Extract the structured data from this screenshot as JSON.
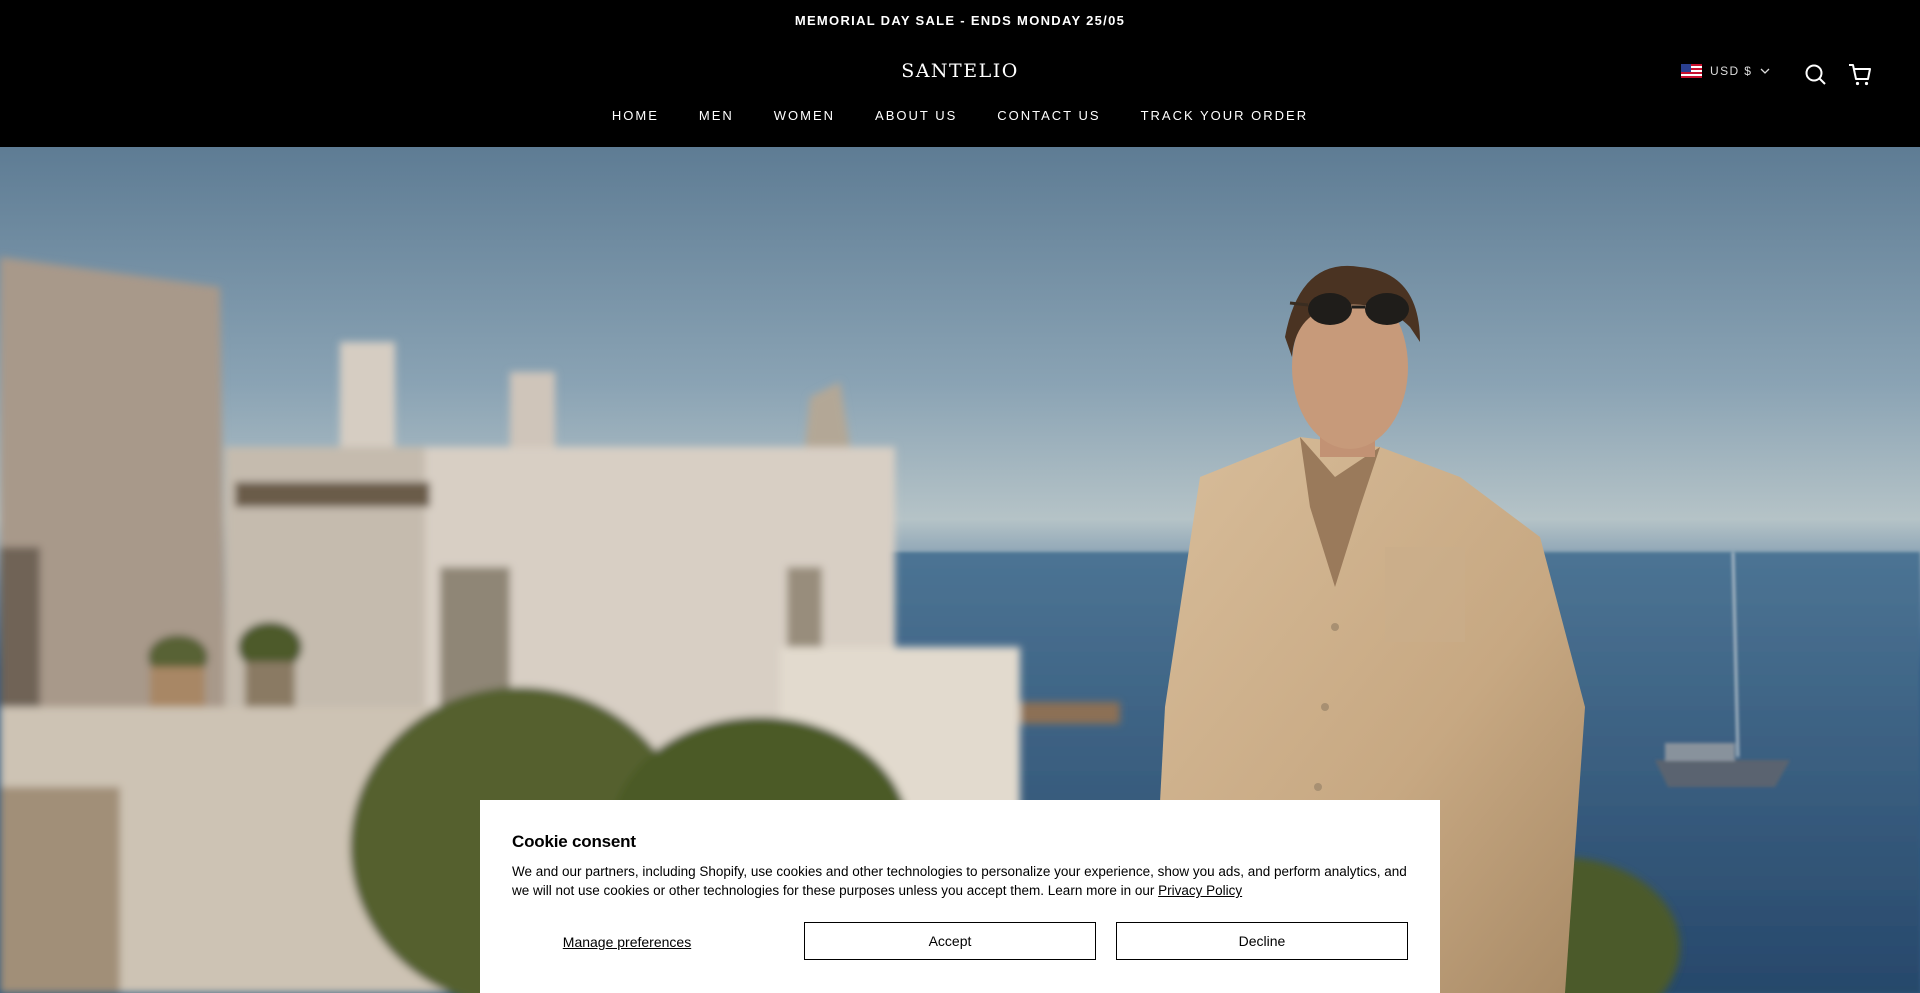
{
  "announcement": {
    "text": "MEMORIAL DAY SALE - ENDS MONDAY 25/05"
  },
  "header": {
    "logo": "SANTELIO",
    "nav": [
      "HOME",
      "MEN",
      "WOMEN",
      "ABOUT US",
      "CONTACT US",
      "TRACK YOUR ORDER"
    ],
    "currency": {
      "label": "USD $",
      "flag_icon": "us-flag-icon"
    },
    "icons": [
      "search-icon",
      "cart-icon",
      "chevron-down-icon"
    ]
  },
  "cookie": {
    "title": "Cookie consent",
    "body": "We and our partners, including Shopify, use cookies and other technologies to personalize your experience, show you ads, and perform analytics, and we will not use cookies or other technologies for these purposes unless you accept them. Learn more in our ",
    "privacy_link": "Privacy Policy",
    "manage_label": "Manage preferences",
    "accept_label": "Accept",
    "decline_label": "Decline"
  },
  "colors": {
    "header_bg": "#000000",
    "header_text": "#ffffff",
    "banner_bg": "#ffffff"
  }
}
